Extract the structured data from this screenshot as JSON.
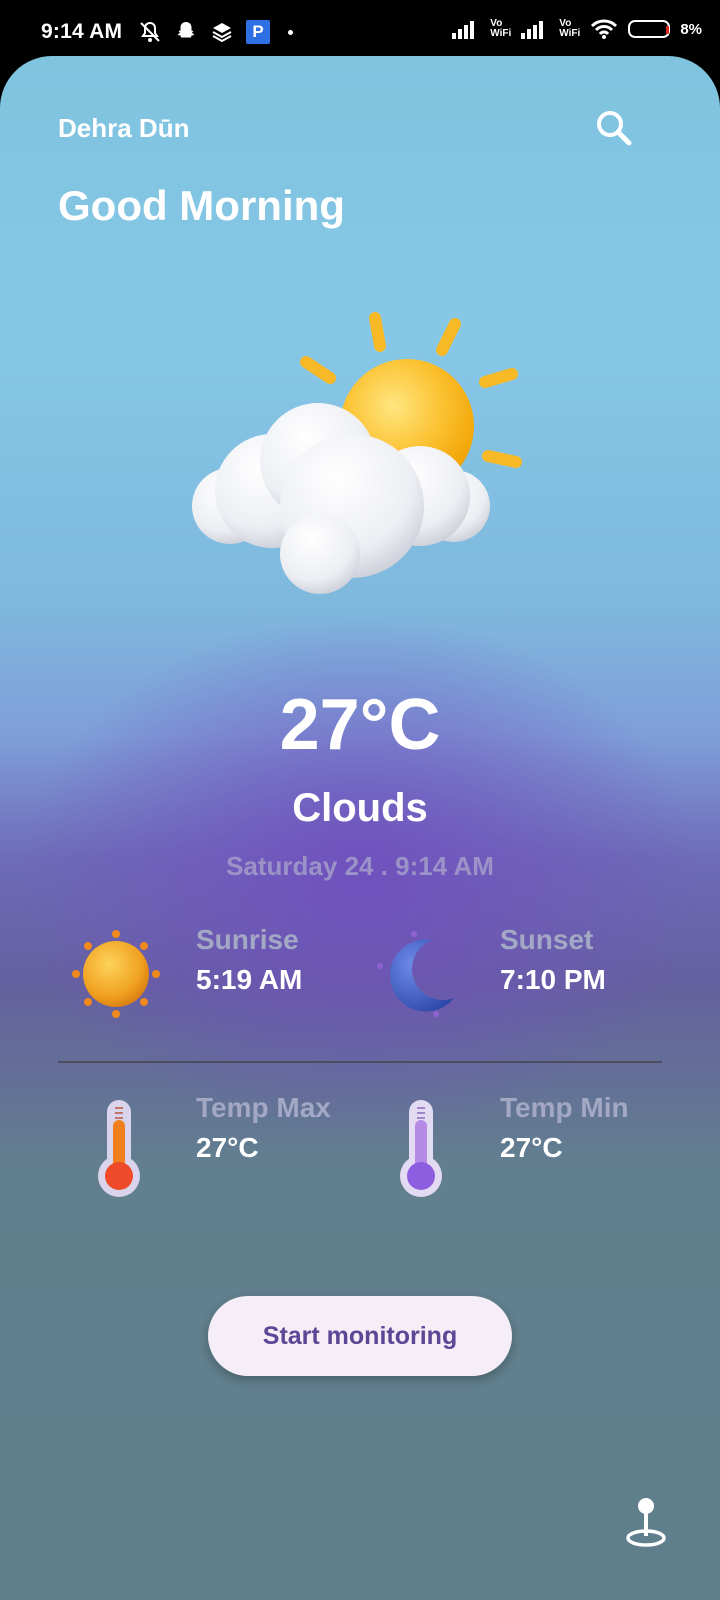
{
  "status_bar": {
    "time": "9:14 AM",
    "vowifi_label_1": "Vo\nWiFi",
    "vowifi_label_2": "Vo\nWiFi",
    "battery": "8%",
    "app_icon_letter": "P"
  },
  "header": {
    "city": "Dehra Dūn",
    "greeting": "Good Morning"
  },
  "current": {
    "temperature": "27°C",
    "condition": "Clouds",
    "datetime": "Saturday 24 . 9:14 AM",
    "icon": "partly-cloudy-sun-icon"
  },
  "details": {
    "sunrise": {
      "label": "Sunrise",
      "value": "5:19 AM",
      "icon": "sun-icon"
    },
    "sunset": {
      "label": "Sunset",
      "value": "7:10 PM",
      "icon": "moon-icon"
    },
    "temp_max": {
      "label": "Temp Max",
      "value": "27°C",
      "icon": "thermometer-hot-icon"
    },
    "temp_min": {
      "label": "Temp Min",
      "value": "27°C",
      "icon": "thermometer-cold-icon"
    }
  },
  "actions": {
    "start_monitoring": "Start monitoring"
  },
  "colors": {
    "button_bg": "#f5eef7",
    "button_text": "#5a4795",
    "sky_top": "#86c7e6",
    "mid_purple": "#6e6bb8",
    "bottom": "#607f8c"
  }
}
